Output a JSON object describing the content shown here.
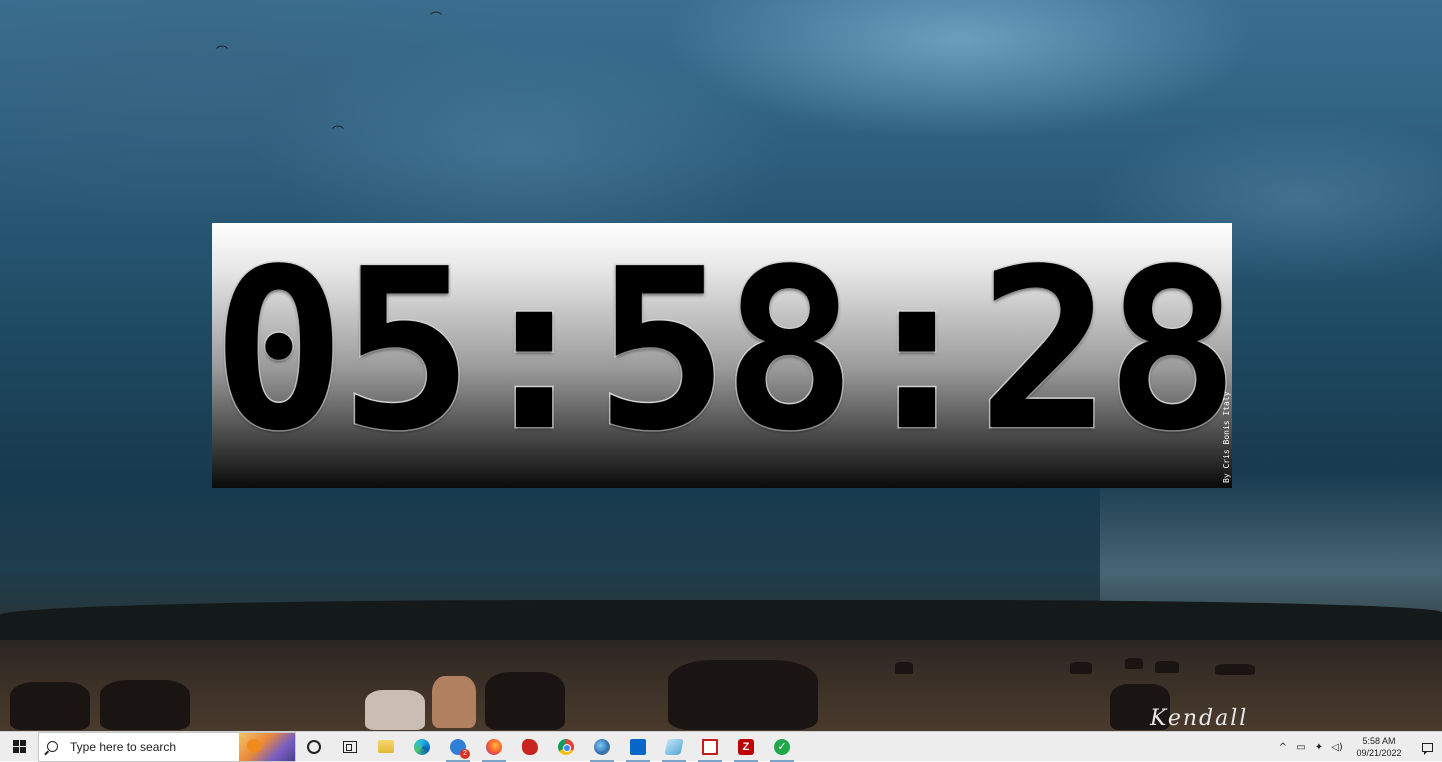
{
  "clock_widget": {
    "time": "05:58:28",
    "credit": "By Cris Bonis Italy"
  },
  "desktop": {
    "signature": "Kendall"
  },
  "taskbar": {
    "search": {
      "placeholder": "Type here to search"
    },
    "pinned": [
      {
        "icon": "cortana-icon"
      },
      {
        "icon": "task-view-icon"
      },
      {
        "icon": "file-explorer-icon"
      },
      {
        "icon": "edge-icon"
      },
      {
        "icon": "mail-icon",
        "badge": "2"
      },
      {
        "icon": "firefox-icon"
      },
      {
        "icon": "paint-icon"
      },
      {
        "icon": "chrome-icon"
      },
      {
        "icon": "globe-icon"
      },
      {
        "icon": "store-icon"
      },
      {
        "icon": "remote-desktop-icon"
      },
      {
        "icon": "media-icon"
      },
      {
        "icon": "filezilla-icon",
        "label": "Z"
      },
      {
        "icon": "check-icon"
      }
    ],
    "mail_badge": "2",
    "filezilla_label": "Z",
    "tray": {
      "time": "5:58 AM",
      "date": "09/21/2022"
    }
  },
  "colors": {
    "taskbar_bg": "#ededed",
    "active_indicator": "#7aa3c8",
    "mail_badge": "#d9331f"
  }
}
